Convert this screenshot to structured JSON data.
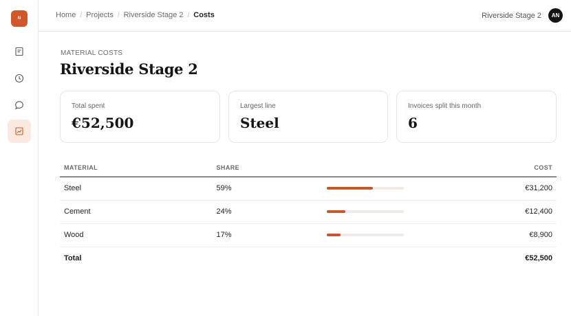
{
  "app": {
    "logo_text": "N"
  },
  "sidebar": {
    "items": [
      {
        "name": "documents",
        "icon": "document-icon"
      },
      {
        "name": "history",
        "icon": "clock-icon"
      },
      {
        "name": "messages",
        "icon": "chat-icon"
      },
      {
        "name": "costs",
        "icon": "chart-icon",
        "active": true
      }
    ]
  },
  "header": {
    "breadcrumbs": [
      "Home",
      "Projects",
      "Riverside Stage 2",
      "Costs"
    ],
    "project_label": "Riverside Stage 2",
    "avatar_initials": "AN"
  },
  "page": {
    "eyebrow": "MATERIAL COSTS",
    "title": "Riverside Stage 2"
  },
  "stats": [
    {
      "label": "Total spent",
      "value": "€52,500"
    },
    {
      "label": "Largest line",
      "value": "Steel"
    },
    {
      "label": "Invoices split this month",
      "value": "6"
    }
  ],
  "table": {
    "headers": {
      "material": "MATERIAL",
      "share": "SHARE",
      "cost": "COST"
    },
    "rows": [
      {
        "material": "Steel",
        "share": "59%",
        "share_value": 0.59,
        "cost": "€31,200"
      },
      {
        "material": "Cement",
        "share": "24%",
        "share_value": 0.24,
        "cost": "€12,400"
      },
      {
        "material": "Wood",
        "share": "17%",
        "share_value": 0.17,
        "cost": "€8,900"
      }
    ],
    "total": {
      "label": "Total",
      "cost": "€52,500"
    }
  },
  "colors": {
    "accent": "#d1582a",
    "bar_fill": "#c4582a",
    "bar_track": "#efebe4",
    "active_nav_bg": "#fbe9e0"
  }
}
